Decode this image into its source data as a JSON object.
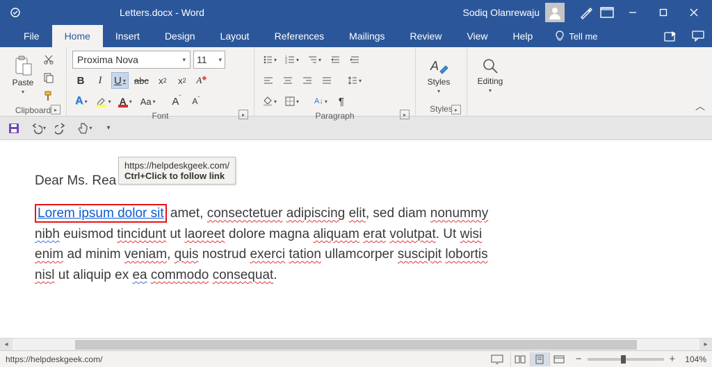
{
  "titlebar": {
    "doc_title": "Letters.docx  -  Word",
    "user_name": "Sodiq Olanrewaju"
  },
  "tabs": {
    "file": "File",
    "home": "Home",
    "insert": "Insert",
    "design": "Design",
    "layout": "Layout",
    "references": "References",
    "mailings": "Mailings",
    "review": "Review",
    "view": "View",
    "help": "Help",
    "tellme": "Tell me"
  },
  "ribbon": {
    "clipboard": {
      "paste": "Paste",
      "group": "Clipboard"
    },
    "font": {
      "name": "Proxima Nova",
      "size": "11",
      "bold": "B",
      "italic": "I",
      "underline": "U",
      "strike": "abc",
      "sub": "x",
      "sup": "x",
      "group": "Font",
      "aa": "Aa"
    },
    "paragraph": {
      "group": "Paragraph"
    },
    "styles": {
      "label": "Styles",
      "group": "Styles"
    },
    "editing": {
      "label": "Editing"
    }
  },
  "tooltip": {
    "url": "https://helpdeskgeek.com/",
    "hint": "Ctrl+Click to follow link"
  },
  "document": {
    "greeting_pre": "Dear Ms. Rea",
    "link_text": "Lorem ipsum dolor sit",
    "p1_after_link": " amet, ",
    "p1_w1": "consectetuer",
    "p1_s1": " ",
    "p1_w2": "adipiscing",
    "p1_s2": " ",
    "p1_w3": "elit",
    "p1_s3": ", sed diam ",
    "p1_w4": "nonummy",
    "p2_a": "nibh",
    "p2_b": " euismod ",
    "p2_c": "tincidunt",
    "p2_d": " ut ",
    "p2_e": "laoreet",
    "p2_f": " dolore magna ",
    "p2_g": "aliquam",
    "p2_h": " ",
    "p2_i": "erat",
    "p2_j": " ",
    "p2_k": "volutpat",
    "p2_l": ". Ut ",
    "p2_m": "wisi",
    "p3_a": "enim",
    "p3_b": " ad minim ",
    "p3_c": "veniam",
    "p3_d": ", ",
    "p3_e": "quis",
    "p3_f": " nostrud ",
    "p3_g": "exerci",
    "p3_h": " ",
    "p3_i": "tation",
    "p3_j": " ullamcorper ",
    "p3_k": "suscipit",
    "p3_l": " ",
    "p3_m": "lobortis",
    "p4_a": "nisl",
    "p4_b": " ut aliquip ex ",
    "p4_c": "ea",
    "p4_d": " ",
    "p4_e": "commodo",
    "p4_f": " ",
    "p4_g": "consequat",
    "p4_h": "."
  },
  "status": {
    "url": "https://helpdeskgeek.com/",
    "zoom": "104%"
  }
}
